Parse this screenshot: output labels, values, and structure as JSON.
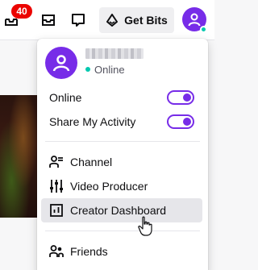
{
  "topbar": {
    "notification_count": "40",
    "get_bits_label": "Get Bits",
    "icons": {
      "inbox": "inbox-icon",
      "whispers": "whispers-icon",
      "bits": "bits-icon",
      "avatar": "user-avatar-icon"
    }
  },
  "profile": {
    "status": "Online"
  },
  "menu": {
    "toggles": [
      {
        "label": "Online",
        "on": true
      },
      {
        "label": "Share My Activity",
        "on": true
      }
    ],
    "items": [
      {
        "label": "Channel",
        "icon": "channel-icon"
      },
      {
        "label": "Video Producer",
        "icon": "video-producer-icon"
      },
      {
        "label": "Creator Dashboard",
        "icon": "creator-dashboard-icon",
        "hovered": true
      },
      {
        "label": "Friends",
        "icon": "friends-icon"
      }
    ]
  },
  "colors": {
    "accent": "#772ce8",
    "online": "#00c8af",
    "badge": "#eb0400",
    "hover_bg": "#e6e6ea"
  }
}
